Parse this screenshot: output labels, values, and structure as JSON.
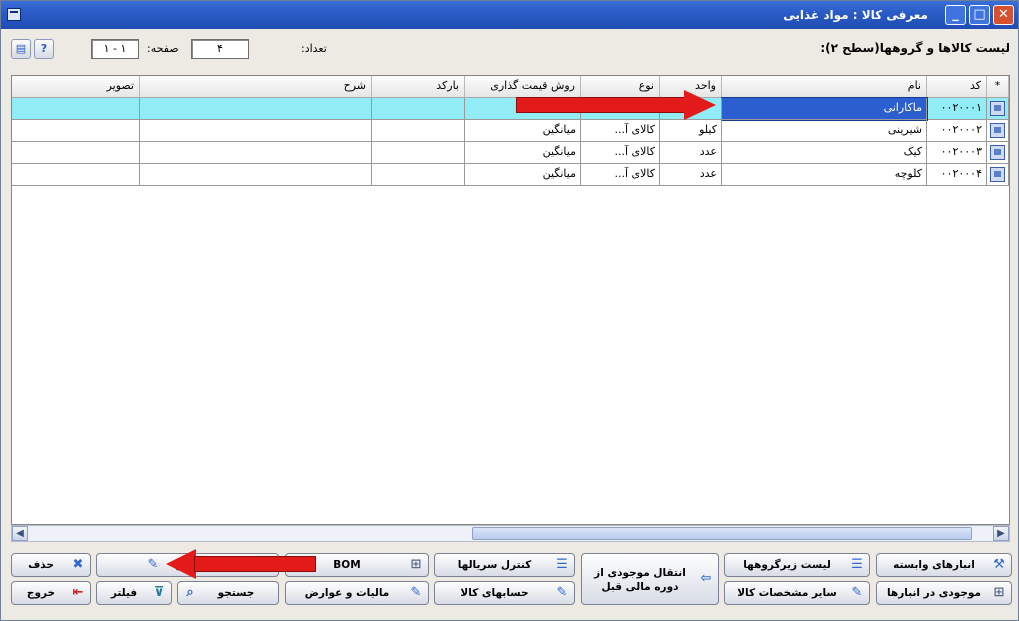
{
  "window": {
    "title": "معرفی کالا : مواد غذایی",
    "close_glyph": "✕",
    "max_glyph": "□",
    "min_glyph": "_"
  },
  "info": {
    "list_title": "لیست کالاها و گروهها(سطح ۲):",
    "count_label": "تعداد:",
    "page_label": "صفحه:",
    "page_value": "۴",
    "range_value": "۱ - ۱"
  },
  "columns": {
    "star": "*",
    "code": "کد",
    "name": "نام",
    "unit": "واحد",
    "type": "نوع",
    "pricing": "روش قیمت گذاری",
    "barcode": "بارکد",
    "desc": "شرح",
    "image": "تصویر"
  },
  "rows": [
    {
      "code": "۰۰۲۰۰۰۱",
      "name": "ماکارانی",
      "unit": "",
      "type": "",
      "pricing": "",
      "barcode": "",
      "desc": "",
      "image": ""
    },
    {
      "code": "۰۰۲۰۰۰۲",
      "name": "شیرینی",
      "unit": "کیلو",
      "type": "کالای آ...",
      "pricing": "میانگین",
      "barcode": "",
      "desc": "",
      "image": ""
    },
    {
      "code": "۰۰۲۰۰۰۳",
      "name": "کیک",
      "unit": "عدد",
      "type": "کالای آ...",
      "pricing": "میانگین",
      "barcode": "",
      "desc": "",
      "image": ""
    },
    {
      "code": "۰۰۲۰۰۰۴",
      "name": "کلوچه",
      "unit": "عدد",
      "type": "کالای آ...",
      "pricing": "میانگین",
      "barcode": "",
      "desc": "",
      "image": ""
    }
  ],
  "buttons": {
    "linked_warehouses": "انبارهای وابسته",
    "subgroups_list": "لیست زیرگروهها",
    "transfer_stock": "انتقال موجودی از دوره مالی قبل",
    "serial_control": "کنترل سریالها",
    "bom": "BOM",
    "edit": "اصلاح",
    "delete": "حذف",
    "stock_in_warehouses": "موجودی در انبارها",
    "other_specs": "سایر مشخصات کالا",
    "item_accounts": "حسابهای کالا",
    "taxes": "مالیات و عوارض",
    "search": "جستجو",
    "filter": "فیلتر",
    "exit": "خروج"
  },
  "colors": {
    "titlebar": "#2a5bc7",
    "selected_row": "#91ecf6",
    "selected_cell": "#2b5fd0",
    "annotation_arrow": "#e21a1a"
  }
}
